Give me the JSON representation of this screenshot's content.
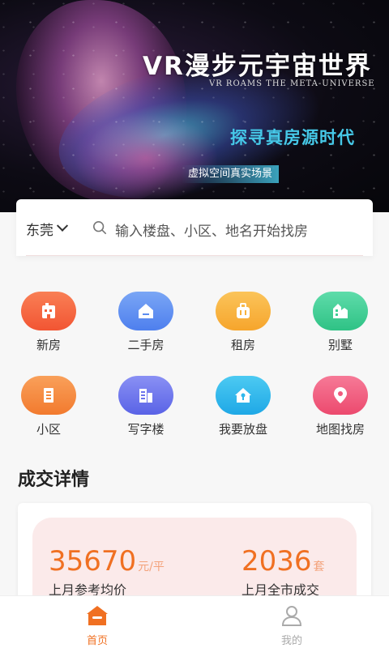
{
  "banner": {
    "title": "VR漫步元宇宙世界",
    "subtitle": "VR ROAMS THE META-UNIVERSE",
    "slogan": "探寻真房源时代",
    "tag": "虚拟空间真实场景"
  },
  "search": {
    "city": "东莞",
    "placeholder": "输入楼盘、小区、地名开始找房"
  },
  "categories": [
    {
      "label": "新房",
      "icon": "building-icon",
      "color": "#f4603a"
    },
    {
      "label": "二手房",
      "icon": "house-icon",
      "color": "#5b8cf0"
    },
    {
      "label": "租房",
      "icon": "suitcase-icon",
      "color": "#f8b13a"
    },
    {
      "label": "别墅",
      "icon": "villa-icon",
      "color": "#3fcf95"
    },
    {
      "label": "小区",
      "icon": "apartment-icon",
      "color": "#f6893c"
    },
    {
      "label": "写字楼",
      "icon": "office-icon",
      "color": "#6c74ec"
    },
    {
      "label": "我要放盘",
      "icon": "key-house-icon",
      "color": "#2fb8ec"
    },
    {
      "label": "地图找房",
      "icon": "map-pin-icon",
      "color": "#f05a7e"
    }
  ],
  "deals": {
    "title": "成交详情",
    "avg_price": "35670",
    "avg_price_unit": "元/平",
    "avg_price_caption": "上月参考均价",
    "deal_count": "2036",
    "deal_count_unit": "套",
    "deal_count_caption": "上月全市成交"
  },
  "nav": {
    "home": "首页",
    "mine": "我的",
    "active_color": "#f07022",
    "inactive_color": "#aaaaaa"
  }
}
